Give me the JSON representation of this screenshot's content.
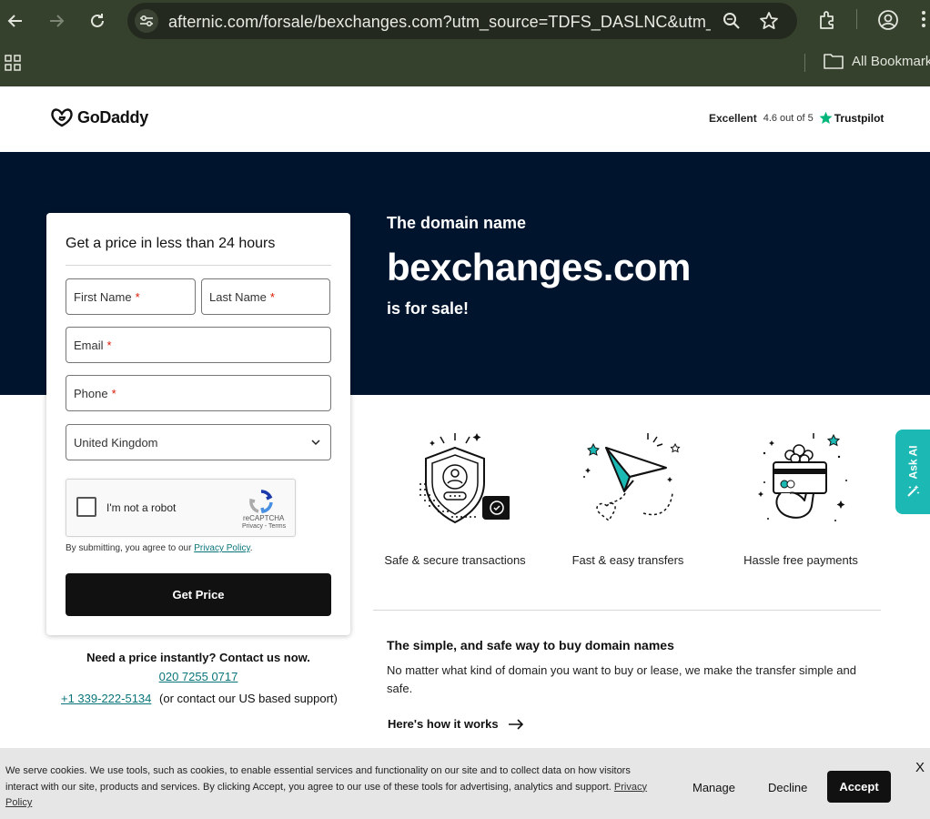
{
  "browser": {
    "url": "afternic.com/forsale/bexchanges.com?utm_source=TDFS_DASLNC&utm_m...",
    "bookmarks_label": "All Bookmarks"
  },
  "header": {
    "logo_text": "GoDaddy",
    "trustpilot": {
      "rating_label": "Excellent",
      "score": "4.6 out of 5",
      "brand": "Trustpilot"
    }
  },
  "hero": {
    "pre": "The domain name",
    "domain": "bexchanges.com",
    "post": "is for sale!"
  },
  "form": {
    "title": "Get a price in less than 24 hours",
    "first_name": "First Name",
    "last_name": "Last Name",
    "email": "Email",
    "phone": "Phone",
    "required_mark": "*",
    "country": "United Kingdom",
    "captcha": {
      "label": "I'm not a robot",
      "brand": "reCAPTCHA",
      "links": "Privacy - Terms"
    },
    "consent_prefix": "By submitting, you agree to our",
    "consent_link": "Privacy Policy",
    "consent_suffix": ".",
    "submit": "Get Price"
  },
  "contact": {
    "question": "Need a price instantly? Contact us now.",
    "uk_phone": "020 7255 0717",
    "us_phone": "+1 339-222-5134",
    "us_note": "(or contact our US based support)"
  },
  "features": [
    {
      "icon": "shield-icon",
      "caption": "Safe & secure transactions"
    },
    {
      "icon": "paper-plane-icon",
      "caption": "Fast & easy transfers"
    },
    {
      "icon": "card-payment-icon",
      "caption": "Hassle free payments"
    }
  ],
  "info": {
    "title": "The simple, and safe way to buy domain names",
    "body": "No matter what kind of domain you want to buy or lease, we make the transfer simple and safe.",
    "link": "Here's how it works"
  },
  "ask_ai": "Ask AI",
  "cookie": {
    "text": "We serve cookies. We use tools, such as cookies, to enable essential services and functionality on our site and to collect data on how visitors interact with our site, products and services. By clicking Accept, you agree to our use of these tools for advertising, analytics and support.",
    "policy_link": "Privacy Policy",
    "manage": "Manage",
    "decline": "Decline",
    "accept": "Accept",
    "close": "X"
  }
}
